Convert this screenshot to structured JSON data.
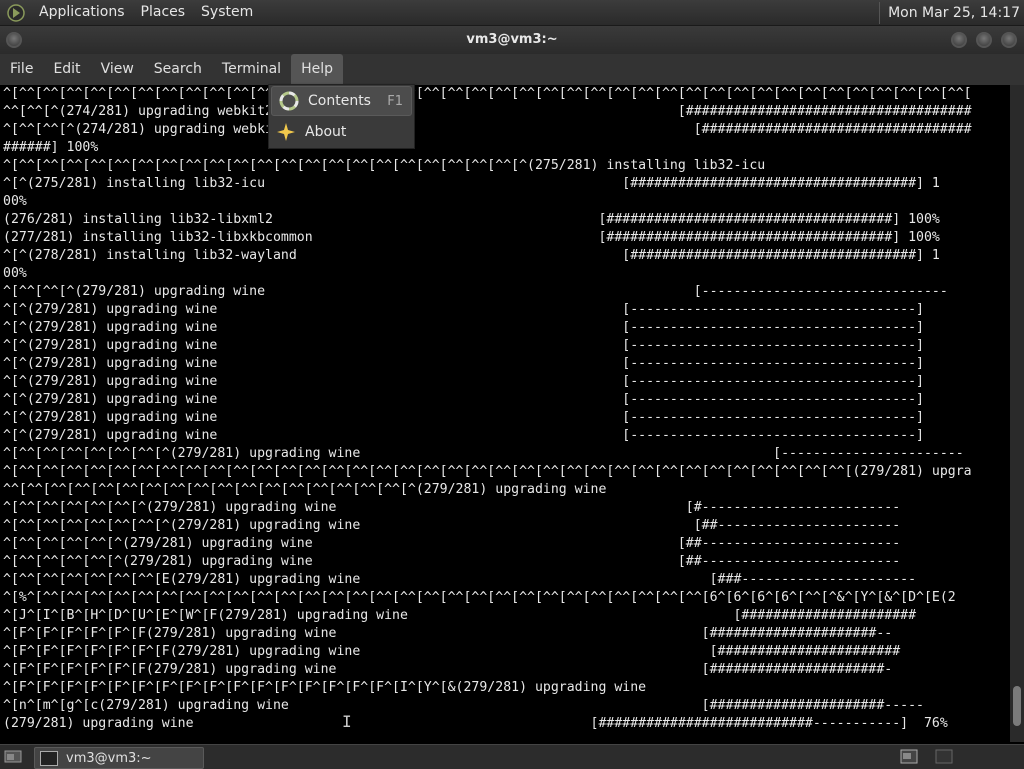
{
  "top_panel": {
    "menus": [
      "Applications",
      "Places",
      "System"
    ],
    "clock": "Mon Mar 25, 14:17"
  },
  "window": {
    "title": "vm3@vm3:~"
  },
  "menubar": [
    "File",
    "Edit",
    "View",
    "Search",
    "Terminal",
    "Help"
  ],
  "help_menu": {
    "items": [
      {
        "label": "Contents",
        "accel": "F1",
        "icon": "help-contents-icon"
      },
      {
        "label": "About",
        "accel": "",
        "icon": "about-star-icon"
      }
    ]
  },
  "terminal": {
    "lines": [
      "^[^^[^^[^^[^^[^^[^^[^^[^^[^^[^^[^^[^^[^^[^^[^^[^^[^^[^^[^^[^^[^^[^^[^^[^^[^^[^^[^^[^^[^^[^^[^^[^^[^^[^^[^^[^^[^^[^^[^^[^^[",
      "^^[^^[^(274/281) upgrading webkit2gtk                                                [####################################",
      "^[^^[^^[^(274/281) upgrading webkit2gtk                                                [##################################",
      "######] 100%",
      "^[^^[^^[^^[^^[^^[^^[^^[^^[^^[^^[^^[^^[^^[^^[^^[^^[^^[^^[^^[^^[^^[^(275/281) installing lib32-icu",
      "^[^(275/281) installing lib32-icu                                             [####################################] 1",
      "00%",
      "(276/281) installing lib32-libxml2                                         [####################################] 100%",
      "(277/281) installing lib32-libxkbcommon                                    [####################################] 100%",
      "^[^(278/281) installing lib32-wayland                                         [####################################] 1",
      "00%",
      "^[^^[^^[^(279/281) upgrading wine                                                      [-------------------------------",
      "^[^(279/281) upgrading wine                                                   [------------------------------------]",
      "^[^(279/281) upgrading wine                                                   [------------------------------------]",
      "^[^(279/281) upgrading wine                                                   [------------------------------------]",
      "^[^(279/281) upgrading wine                                                   [------------------------------------]",
      "^[^(279/281) upgrading wine                                                   [------------------------------------]",
      "^[^(279/281) upgrading wine                                                   [------------------------------------]",
      "^[^(279/281) upgrading wine                                                   [------------------------------------]",
      "^[^(279/281) upgrading wine                                                   [------------------------------------]",
      "^[^^[^^[^^[^^[^^[^^[^(279/281) upgrading wine                                                    [-----------------------",
      "^[^^[^^[^^[^^[^^[^^[^^[^^[^^[^^[^^[^^[^^[^^[^^[^^[^^[^^[^^[^^[^^[^^[^^[^^[^^[^^[^^[^^[^^[^^[^^[^^[^^[^^[^^[(279/281) upgra",
      "^^[^^[^^[^^[^^[^^[^^[^^[^^[^^[^^[^^[^^[^^[^^[^^[^^[^(279/281) upgrading wine",
      "^[^^[^^[^^[^^[^^[^(279/281) upgrading wine                                            [#-------------------------",
      "^[^^[^^[^^[^^[^^[^^[^(279/281) upgrading wine                                          [##-----------------------",
      "^[^^[^^[^^[^^[^(279/281) upgrading wine                                              [##-------------------------",
      "^[^^[^^[^^[^^[^(279/281) upgrading wine                                              [##-------------------------",
      "^[^^[^^[^^[^^[^^[^^[E(279/281) upgrading wine                                            [###----------------------",
      "^[%^[^^[^^[^^[^^[^^[^^[^^[^^[^^[^^[^^[^^[^^[^^[^^[^^[^^[^^[^^[^^[^^[^^[^^[^^[^^[^^[^^[^^[6^[6^[6^[6^[^^[^&^[Y^[&^[D^[E(2",
      "^[J^[I^[B^[H^[D^[U^[E^[W^[F(279/281) upgrading wine                                         [######################",
      "^[F^[F^[F^[F^[F^[F(279/281) upgrading wine                                              [#####################--",
      "^[F^[F^[F^[F^[F^[F^[F(279/281) upgrading wine                                            [#######################",
      "^[F^[F^[F^[F^[F^[F(279/281) upgrading wine                                              [######################-",
      "^[F^[F^[F^[F^[F^[F^[F^[F^[F^[F^[F^[F^[F^[F^[F^[F^[I^[Y^[&(279/281) upgrading wine",
      "^[n^[m^[g^[c(279/281) upgrading wine                                                    [######################-----",
      "(279/281) upgrading wine                                                  [###########################-----------]  76%"
    ]
  },
  "scrollbar": {
    "position_fraction": 0.98
  },
  "taskbar": {
    "window_button": "vm3@vm3:~"
  }
}
